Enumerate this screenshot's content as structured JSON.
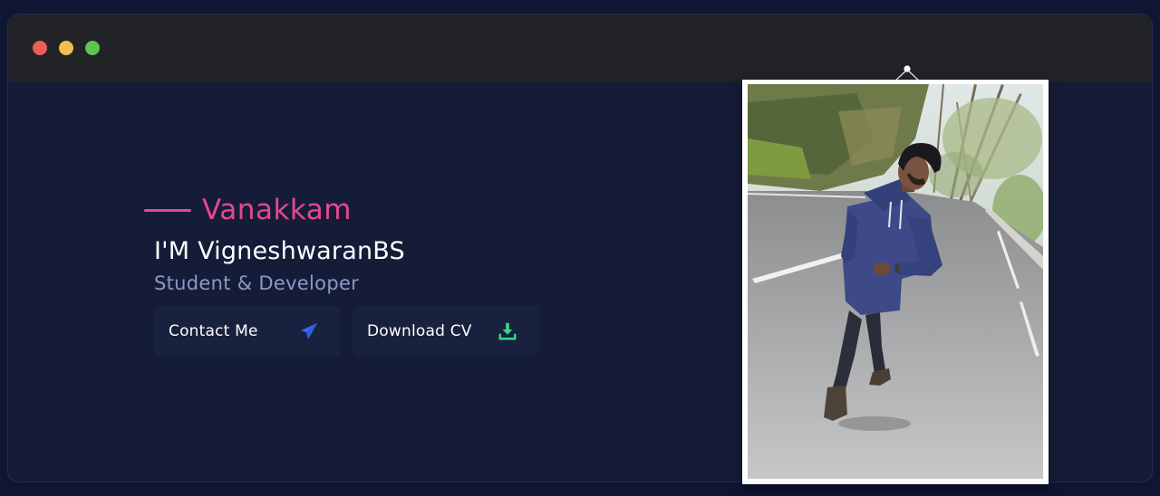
{
  "window": {
    "controls": [
      {
        "name": "close",
        "color": "#ed5e57"
      },
      {
        "name": "minimize",
        "color": "#f3bd4f"
      },
      {
        "name": "maximize",
        "color": "#5fc552"
      }
    ]
  },
  "hero": {
    "greeting": "Vanakkam",
    "greeting_color": "#e5498c",
    "name": "I'M VigneshwaranBS",
    "role": "Student & Developer",
    "buttons": [
      {
        "label": "Contact Me",
        "icon": "paper-plane-icon",
        "icon_color": "#2f6bf3"
      },
      {
        "label": "Download CV",
        "icon": "download-icon",
        "icon_color": "#3fd38c"
      }
    ]
  },
  "photo": {
    "icon": "profile-photo"
  }
}
